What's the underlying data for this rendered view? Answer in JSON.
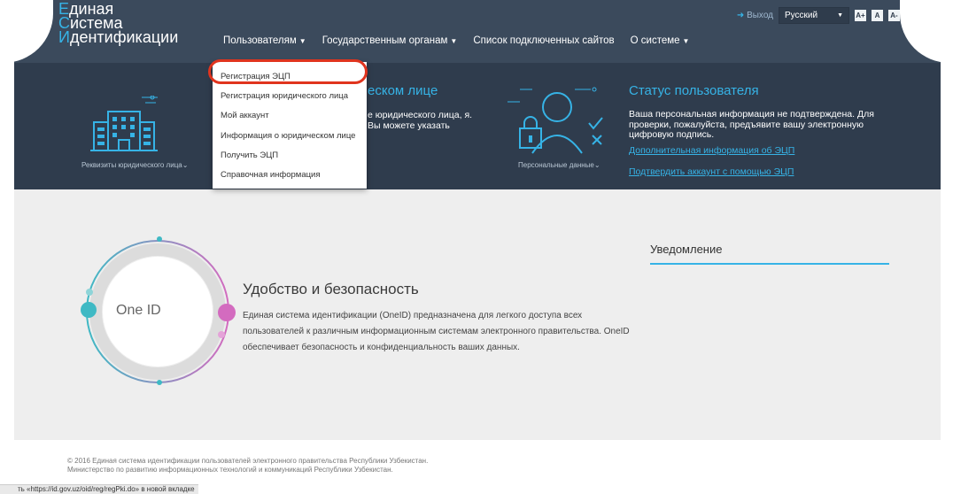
{
  "logo": {
    "line1_first": "Е",
    "line1_rest": "диная",
    "line2_first": "С",
    "line2_rest": "истема",
    "line3_first": "И",
    "line3_rest": "дентификации"
  },
  "nav": {
    "users": "Пользователям",
    "gov": "Государственным органам",
    "sites": "Список подключенных сайтов",
    "about": "О системе"
  },
  "utils": {
    "logout": "Выход",
    "language": "Русский",
    "font_labels": [
      "A+",
      "A",
      "A-"
    ]
  },
  "dropdown": {
    "items": [
      "Регистрация ЭЦП",
      "Регистрация юридического лица",
      "Мой аккаунт",
      "Информация о юридическом лице",
      "Получить ЭЦП",
      "Справочная информация"
    ]
  },
  "legal": {
    "caption": "Реквизиты юридического лица",
    "heading_partial": "еском лице",
    "desc_partial": "е юридического лица, я. Вы можете указать"
  },
  "personal": {
    "caption": "Персональные данные"
  },
  "status": {
    "title": "Статус пользователя",
    "text": "Ваша персональная информация не подтверждена. Для проверки, пожалуйста, предъявите вашу электронную цифровую подпись.",
    "link1": "Дополнительная информация об ЭЦП",
    "link2": "Подтвердить аккаунт с помощью ЭЦП"
  },
  "feature": {
    "ring_label": "One ID",
    "title": "Удобство и безопасность",
    "text": "Единая система идентификации (OneID) предназначена для легкого доступа всех пользователей к различным информационным системам электронного правительства. OneID обеспечивает безопасность и конфиденциальность ваших данных."
  },
  "notice": {
    "title": "Уведомление"
  },
  "footer": {
    "line1": "© 2016 Единая система идентификации пользователей электронного правительства Республики Узбекистан.",
    "line2": "Министерство по развитию информационных технологий и коммуникаций Республики Узбекистан."
  },
  "statusbar": {
    "text": "ть «https://id.gov.uz/oid/reg/regPki.do» в новой вкладке"
  },
  "colors": {
    "header": "#3b4a5c",
    "band": "#2f3c4d",
    "accent": "#36b3e6",
    "highlight": "#e0341e",
    "main_bg": "#eeeeee"
  }
}
